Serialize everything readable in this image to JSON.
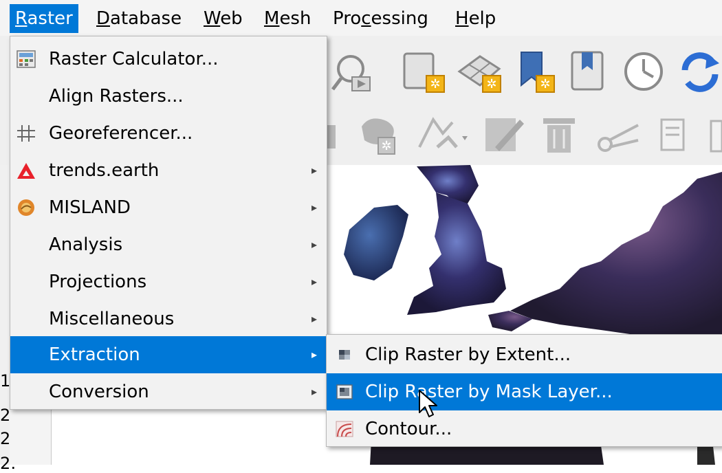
{
  "menubar": {
    "items": [
      {
        "label": "Raster",
        "underline": "R",
        "rest": "aster",
        "active": true
      },
      {
        "label": "Database",
        "underline": "D",
        "rest": "atabase"
      },
      {
        "label": "Web",
        "underline": "W",
        "rest": "eb"
      },
      {
        "label": "Mesh",
        "underline": "M",
        "rest": "esh"
      },
      {
        "label": "Processing",
        "pre": "Pro",
        "underline": "c",
        "rest": "essing"
      },
      {
        "label": "Help",
        "underline": "H",
        "rest": "elp"
      }
    ]
  },
  "raster_menu": {
    "items": [
      {
        "label": "Raster Calculator...",
        "icon": "calculator-icon",
        "submenu": false
      },
      {
        "label": "Align Rasters...",
        "icon": "",
        "submenu": false
      },
      {
        "label": "Georeferencer...",
        "icon": "grid-icon",
        "submenu": false
      },
      {
        "label": "trends.earth",
        "icon": "trends-earth-icon",
        "submenu": true
      },
      {
        "label": "MISLAND",
        "icon": "misland-icon",
        "submenu": true
      },
      {
        "label": "Analysis",
        "icon": "",
        "submenu": true
      },
      {
        "label": "Projections",
        "icon": "",
        "submenu": true
      },
      {
        "label": "Miscellaneous",
        "icon": "",
        "submenu": true
      },
      {
        "label": "Extraction",
        "icon": "",
        "submenu": true,
        "selected": true
      },
      {
        "label": "Conversion",
        "icon": "",
        "submenu": true
      }
    ]
  },
  "extraction_submenu": {
    "items": [
      {
        "label": "Clip Raster by Extent...",
        "icon": "clip-extent-icon"
      },
      {
        "label": "Clip Raster by Mask Layer...",
        "icon": "clip-mask-icon",
        "selected": true
      },
      {
        "label": "Contour...",
        "icon": "contour-icon"
      }
    ]
  },
  "side_rows": [
    "1",
    "2:",
    "2:",
    "2:"
  ],
  "colors": {
    "accent": "#0078d7",
    "menu_bg": "#f2f2f2",
    "trends_red": "#e8202a"
  }
}
